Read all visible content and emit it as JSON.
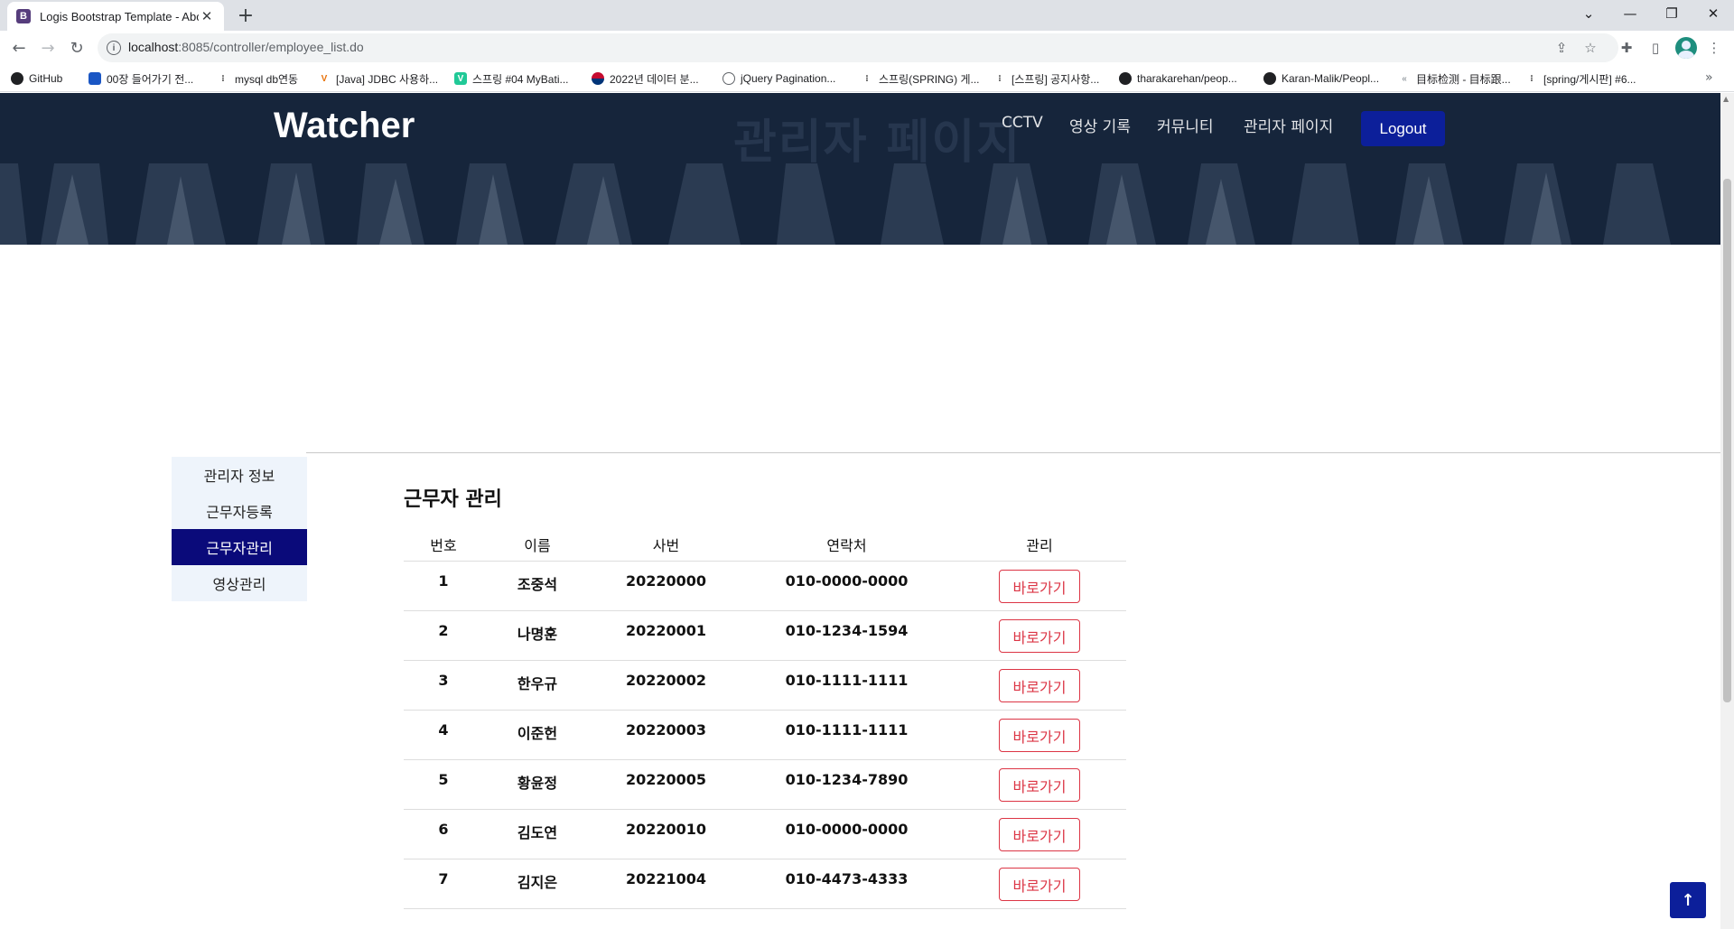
{
  "browser": {
    "tab_title": "Logis Bootstrap Template - Abo",
    "url_host": "localhost",
    "url_rest": ":8085/controller/employee_list.do",
    "bookmarks": [
      {
        "label": "GitHub",
        "icon": "github-icon",
        "color": "#202124"
      },
      {
        "label": "00장 들어가기 전...",
        "icon": "book-icon",
        "color": "#1a56c4"
      },
      {
        "label": "mysql db연동",
        "icon": "velog-icon",
        "color": "#2b2b2b"
      },
      {
        "label": "[Java] JDBC 사용하...",
        "icon": "v-icon",
        "color": "#e8730c"
      },
      {
        "label": "스프링 #04 MyBati...",
        "icon": "v-square-icon",
        "color": "#20c997"
      },
      {
        "label": "2022년 데이터 분...",
        "icon": "korea-flag-icon",
        "color": "#c60c30"
      },
      {
        "label": "jQuery Pagination...",
        "icon": "globe-icon",
        "color": "#5f6368"
      },
      {
        "label": "스프링(SPRING) 게...",
        "icon": "velog-icon",
        "color": "#2b2b2b"
      },
      {
        "label": "[스프링] 공지사항...",
        "icon": "velog-icon",
        "color": "#2b2b2b"
      },
      {
        "label": "tharakarehan/peop...",
        "icon": "github-icon",
        "color": "#202124"
      },
      {
        "label": "Karan-Malik/Peopl...",
        "icon": "github-icon",
        "color": "#202124"
      },
      {
        "label": "目标检测 - 目标跟...",
        "icon": "csdn-icon",
        "color": "#9aa0a6"
      },
      {
        "label": "[spring/게시판] #6...",
        "icon": "velog-icon",
        "color": "#2b2b2b"
      }
    ]
  },
  "header": {
    "logo": "Watcher",
    "watermark": "관리자 페이지",
    "nav": [
      "CCTV",
      "영상 기록",
      "커뮤니티",
      "관리자 페이지"
    ],
    "logout_label": "Logout"
  },
  "sidebar": {
    "items": [
      {
        "label": "관리자 정보",
        "active": false
      },
      {
        "label": "근무자등록",
        "active": false
      },
      {
        "label": "근무자관리",
        "active": true
      },
      {
        "label": "영상관리",
        "active": false
      }
    ]
  },
  "main": {
    "title": "근무자 관리",
    "columns": [
      "번호",
      "이름",
      "사번",
      "연락처",
      "관리"
    ],
    "rows": [
      {
        "no": "1",
        "name": "조중석",
        "emp_id": "20220000",
        "phone": "010-0000-0000",
        "action": "바로가기"
      },
      {
        "no": "2",
        "name": "나명훈",
        "emp_id": "20220001",
        "phone": "010-1234-1594",
        "action": "바로가기"
      },
      {
        "no": "3",
        "name": "한우규",
        "emp_id": "20220002",
        "phone": "010-1111-1111",
        "action": "바로가기"
      },
      {
        "no": "4",
        "name": "이준헌",
        "emp_id": "20220003",
        "phone": "010-1111-1111",
        "action": "바로가기"
      },
      {
        "no": "5",
        "name": "황윤정",
        "emp_id": "20220005",
        "phone": "010-1234-7890",
        "action": "바로가기"
      },
      {
        "no": "6",
        "name": "김도연",
        "emp_id": "20220010",
        "phone": "010-0000-0000",
        "action": "바로가기"
      },
      {
        "no": "7",
        "name": "김지은",
        "emp_id": "20221004",
        "phone": "010-4473-4333",
        "action": "바로가기"
      }
    ]
  },
  "colors": {
    "header_bg": "#15243b",
    "accent_blue": "#0c1f9a",
    "active_menu": "#0a0a7a",
    "danger": "#dc3545"
  }
}
